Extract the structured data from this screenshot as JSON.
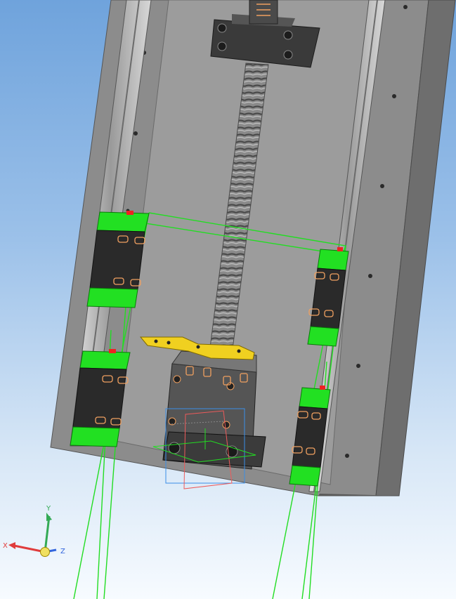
{
  "viewport": {
    "background_top": "#6fa3dc",
    "background_bottom": "#f7fbff"
  },
  "colors": {
    "plate": "#8f8f8f",
    "plate_edge": "#5f5f5f",
    "rail": "#cfcfcf",
    "carriage_body": "#2a2a2a",
    "carriage_highlight": "#22e022",
    "selection": "#22dd22",
    "screw_nut": "#f0d020",
    "hole_markers": "#f0a060",
    "axis_x": "#e03c3c",
    "axis_y": "#33aa55",
    "axis_z": "#3366dd"
  },
  "triad": {
    "x_label": "X",
    "y_label": "Y",
    "z_label": "Z"
  }
}
